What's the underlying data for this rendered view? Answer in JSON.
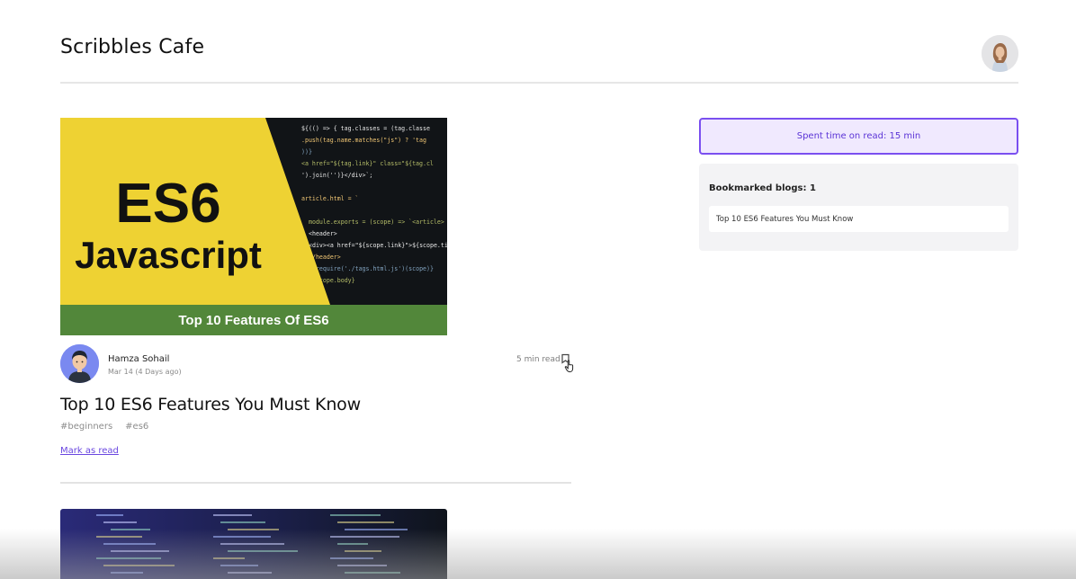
{
  "header": {
    "site_title": "Scribbles Cafe",
    "avatar_icon": "user-avatar-icon"
  },
  "blog": {
    "cover": {
      "headline": "ES6",
      "subheadline": "Javascript",
      "banner": "Top 10 Features Of ES6",
      "code_lines": [
        "${(() => { tag.classes = (tag.classe",
        "  .push(tag.name.matches(\"js\") ? 'tag",
        "))}",
        "<a href=\"${tag.link}\" class=\"${tag.cl",
        "').join('')}</div>`;",
        "",
        "article.html = `",
        "",
        "module.exports = (scope) => `<article>",
        "  <header>",
        "    <div><a href=\"${scope.link}\">${scope.ti",
        "  </header>",
        "  ${require('./tags.html.js')(scope)}",
        "  ${scope.body}",
        "`;"
      ],
      "colors": {
        "left": "#eed233",
        "right": "#111417",
        "banner": "#52873a"
      }
    },
    "author": "Hamza Sohail",
    "date": "Mar 14 (4 Days ago)",
    "read_time": "5 min read",
    "bookmark_icon": "bookmark-icon",
    "title": "Top 10 ES6 Features You Must Know",
    "tags": [
      "#beginners",
      "#es6"
    ],
    "mark_as_read": "Mark as read"
  },
  "sidebar": {
    "spent_time": "Spent time on read: 15 min",
    "bookmarked_heading": "Bookmarked blogs: 1",
    "bookmarked_items": [
      "Top 10 ES6 Features You Must Know"
    ]
  },
  "colors": {
    "accent": "#7a4ff0",
    "accent_bg": "#f0e9fe",
    "link": "#6a47e0"
  }
}
